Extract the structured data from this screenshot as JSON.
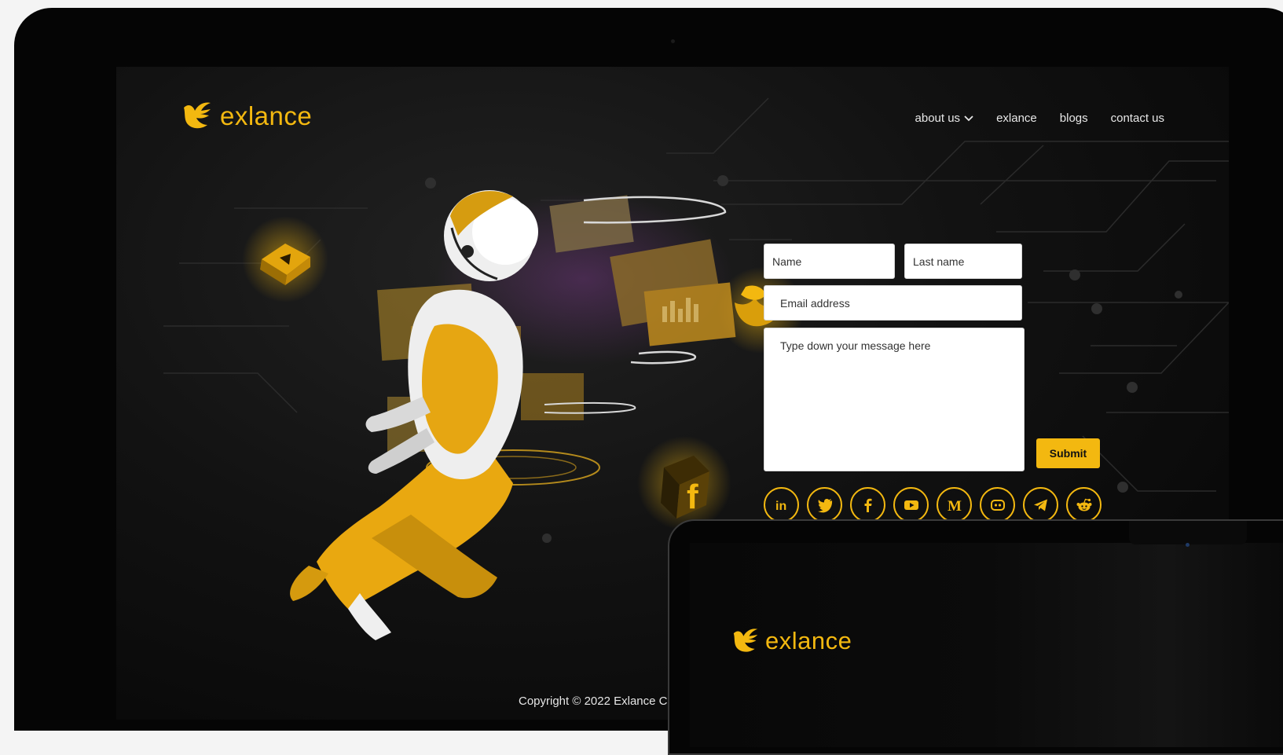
{
  "brand": {
    "name": "exlance",
    "accent_color": "#f3b810",
    "logo_icon": "bird-logo-icon"
  },
  "nav": {
    "items": [
      {
        "label": "about us",
        "has_dropdown": true
      },
      {
        "label": "exlance"
      },
      {
        "label": "blogs"
      },
      {
        "label": "contact us"
      }
    ]
  },
  "form": {
    "name_placeholder": "Name",
    "last_name_placeholder": "Last name",
    "email_placeholder": "Email address",
    "message_placeholder": "Type down your message here",
    "submit_label": "Submit"
  },
  "socials": [
    {
      "icon": "linkedin-icon",
      "glyph": "in"
    },
    {
      "icon": "twitter-icon"
    },
    {
      "icon": "facebook-icon",
      "glyph": "f"
    },
    {
      "icon": "youtube-icon"
    },
    {
      "icon": "medium-icon",
      "glyph": "M"
    },
    {
      "icon": "discord-icon"
    },
    {
      "icon": "telegram-icon"
    },
    {
      "icon": "reddit-icon"
    }
  ],
  "footer": {
    "copyright": "Copyright ©  2022 Exlance C"
  },
  "second_device": {
    "brand_name": "exlance"
  }
}
